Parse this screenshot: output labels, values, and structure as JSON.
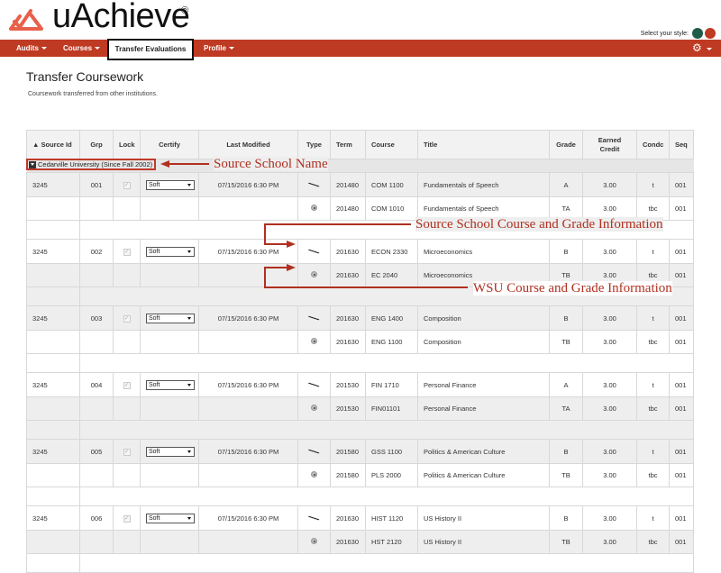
{
  "app": {
    "name": "uAchieve",
    "registered_mark": "®",
    "style_label": "Select your style:",
    "style_colors": [
      "#1f5c4a",
      "#bf3a23"
    ],
    "brand_color": "#bf3a23"
  },
  "nav": {
    "items": [
      {
        "label": "Audits",
        "has_menu": true
      },
      {
        "label": "Courses",
        "has_menu": true
      },
      {
        "label": "Transfer Evaluations",
        "has_menu": false,
        "active": true
      },
      {
        "label": "Profile",
        "has_menu": true
      }
    ],
    "settings_icon": "gear-icon"
  },
  "page": {
    "title": "Transfer Coursework",
    "subtitle": "Coursework transferred from other institutions."
  },
  "table": {
    "columns": [
      "▲ Source Id",
      "Grp",
      "Lock",
      "Certify",
      "Last Modified",
      "Type",
      "Term",
      "Course",
      "Title",
      "Grade",
      "Earned Credit",
      "Condc",
      "Seq"
    ],
    "school": "Cedarville University (Since Fall 2002)",
    "groups": [
      {
        "source_id": "3245",
        "grp": "001",
        "locked": true,
        "certify": "Soft",
        "modified": "07/15/2016 6:30 PM",
        "source": {
          "type": "wrench-icon",
          "term": "201480",
          "course": "COM 1100",
          "title": "Fundamentals of Speech",
          "grade": "A",
          "credit": "3.00",
          "condc": "t",
          "seq": "001"
        },
        "wsu": {
          "type": "radio-icon",
          "term": "201480",
          "course": "COM 1010",
          "title": "Fundamentals of Speech",
          "grade": "TA",
          "credit": "3.00",
          "condc": "tbc",
          "seq": "001"
        }
      },
      {
        "source_id": "3245",
        "grp": "002",
        "locked": true,
        "certify": "Soft",
        "modified": "07/15/2016 6:30 PM",
        "source": {
          "type": "wrench-icon",
          "term": "201630",
          "course": "ECON 2330",
          "title": "Microeconomics",
          "grade": "B",
          "credit": "3.00",
          "condc": "t",
          "seq": "001"
        },
        "wsu": {
          "type": "radio-icon",
          "term": "201630",
          "course": "EC 2040",
          "title": "Microeconomics",
          "grade": "TB",
          "credit": "3.00",
          "condc": "tbc",
          "seq": "001"
        }
      },
      {
        "source_id": "3245",
        "grp": "003",
        "locked": true,
        "certify": "Soft",
        "modified": "07/15/2016 6:30 PM",
        "source": {
          "type": "wrench-icon",
          "term": "201630",
          "course": "ENG 1400",
          "title": "Composition",
          "grade": "B",
          "credit": "3.00",
          "condc": "t",
          "seq": "001"
        },
        "wsu": {
          "type": "radio-icon",
          "term": "201630",
          "course": "ENG 1100",
          "title": "Composition",
          "grade": "TB",
          "credit": "3.00",
          "condc": "tbc",
          "seq": "001"
        }
      },
      {
        "source_id": "3245",
        "grp": "004",
        "locked": true,
        "certify": "Soft",
        "modified": "07/15/2016 6:30 PM",
        "source": {
          "type": "wrench-icon",
          "term": "201530",
          "course": "FIN 1710",
          "title": "Personal Finance",
          "grade": "A",
          "credit": "3.00",
          "condc": "t",
          "seq": "001"
        },
        "wsu": {
          "type": "radio-icon",
          "term": "201530",
          "course": "FIN01101",
          "title": "Personal Finance",
          "grade": "TA",
          "credit": "3.00",
          "condc": "tbc",
          "seq": "001"
        }
      },
      {
        "source_id": "3245",
        "grp": "005",
        "locked": true,
        "certify": "Soft",
        "modified": "07/15/2016 6:30 PM",
        "source": {
          "type": "wrench-icon",
          "term": "201580",
          "course": "GSS 1100",
          "title": "Politics & American Culture",
          "grade": "B",
          "credit": "3.00",
          "condc": "t",
          "seq": "001"
        },
        "wsu": {
          "type": "radio-icon",
          "term": "201580",
          "course": "PLS 2000",
          "title": "Politics & American Culture",
          "grade": "TB",
          "credit": "3.00",
          "condc": "tbc",
          "seq": "001"
        }
      },
      {
        "source_id": "3245",
        "grp": "006",
        "locked": true,
        "certify": "Soft",
        "modified": "07/15/2016 6:30 PM",
        "source": {
          "type": "wrench-icon",
          "term": "201630",
          "course": "HIST 1120",
          "title": "US History II",
          "grade": "B",
          "credit": "3.00",
          "condc": "t",
          "seq": "001"
        },
        "wsu": {
          "type": "radio-icon",
          "term": "201630",
          "course": "HST 2120",
          "title": "US History II",
          "grade": "TB",
          "credit": "3.00",
          "condc": "tbc",
          "seq": "001"
        }
      }
    ]
  },
  "annotations": {
    "school_name": "Source School Name",
    "source_info": "Source School Course and Grade Information",
    "wsu_info": "WSU Course and Grade Information",
    "color": "#b03020"
  }
}
